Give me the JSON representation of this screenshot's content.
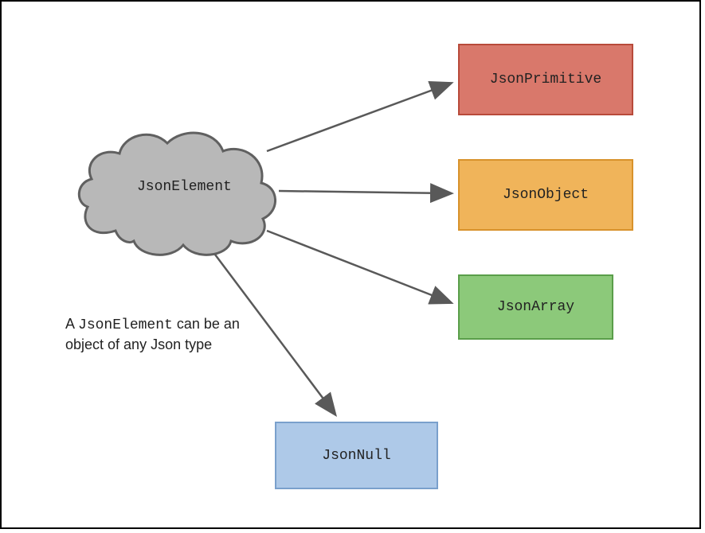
{
  "diagram": {
    "source": {
      "label": "JsonElement"
    },
    "targets": [
      {
        "label": "JsonPrimitive",
        "kind": "primitive"
      },
      {
        "label": "JsonObject",
        "kind": "object"
      },
      {
        "label": "JsonArray",
        "kind": "array"
      },
      {
        "label": "JsonNull",
        "kind": "null"
      }
    ],
    "caption_a": "A ",
    "caption_mono": "JsonElement",
    "caption_rest": " can be an object of any Json type"
  },
  "colors": {
    "primitive_fill": "#d9786b",
    "primitive_stroke": "#b84a3a",
    "object_fill": "#f0b45a",
    "object_stroke": "#d8922b",
    "array_fill": "#8cc97a",
    "array_stroke": "#5a9e4a",
    "null_fill": "#aec9e8",
    "null_stroke": "#7aa0cc",
    "cloud_fill": "#b8b8b8",
    "cloud_stroke": "#606060",
    "arrow": "#595959"
  }
}
